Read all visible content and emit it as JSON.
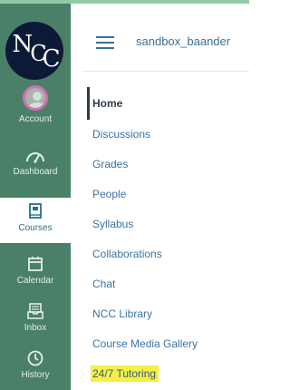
{
  "app": {
    "logo_text": "NCC",
    "accent_color": "#93c9a5",
    "nav_color": "#4a8068"
  },
  "global_nav": {
    "items": [
      {
        "label": "Account",
        "icon": "avatar-icon",
        "active": false
      },
      {
        "label": "Dashboard",
        "icon": "dashboard-icon",
        "active": false
      },
      {
        "label": "Courses",
        "icon": "courses-icon",
        "active": true
      },
      {
        "label": "Calendar",
        "icon": "calendar-icon",
        "active": false
      },
      {
        "label": "Inbox",
        "icon": "inbox-icon",
        "active": false
      },
      {
        "label": "History",
        "icon": "history-icon",
        "active": false
      }
    ]
  },
  "header": {
    "menu_icon": "hamburger-icon",
    "breadcrumb": "sandbox_baander"
  },
  "course_nav": {
    "items": [
      {
        "label": "Home",
        "active": true
      },
      {
        "label": "Discussions"
      },
      {
        "label": "Grades"
      },
      {
        "label": "People"
      },
      {
        "label": "Syllabus"
      },
      {
        "label": "Collaborations"
      },
      {
        "label": "Chat"
      },
      {
        "label": "NCC Library"
      },
      {
        "label": "Course Media Gallery"
      },
      {
        "label": "24/7 Tutoring",
        "highlighted": true,
        "highlight_color": "#f7ef45"
      }
    ]
  }
}
